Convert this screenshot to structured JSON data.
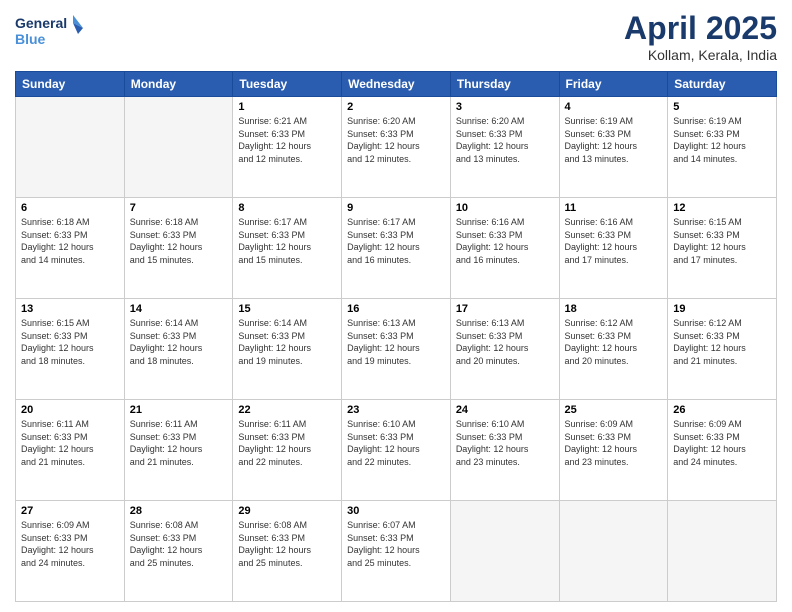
{
  "logo": {
    "line1": "General",
    "line2": "Blue"
  },
  "title": "April 2025",
  "subtitle": "Kollam, Kerala, India",
  "weekdays": [
    "Sunday",
    "Monday",
    "Tuesday",
    "Wednesday",
    "Thursday",
    "Friday",
    "Saturday"
  ],
  "weeks": [
    [
      {
        "day": "",
        "info": ""
      },
      {
        "day": "",
        "info": ""
      },
      {
        "day": "1",
        "info": "Sunrise: 6:21 AM\nSunset: 6:33 PM\nDaylight: 12 hours\nand 12 minutes."
      },
      {
        "day": "2",
        "info": "Sunrise: 6:20 AM\nSunset: 6:33 PM\nDaylight: 12 hours\nand 12 minutes."
      },
      {
        "day": "3",
        "info": "Sunrise: 6:20 AM\nSunset: 6:33 PM\nDaylight: 12 hours\nand 13 minutes."
      },
      {
        "day": "4",
        "info": "Sunrise: 6:19 AM\nSunset: 6:33 PM\nDaylight: 12 hours\nand 13 minutes."
      },
      {
        "day": "5",
        "info": "Sunrise: 6:19 AM\nSunset: 6:33 PM\nDaylight: 12 hours\nand 14 minutes."
      }
    ],
    [
      {
        "day": "6",
        "info": "Sunrise: 6:18 AM\nSunset: 6:33 PM\nDaylight: 12 hours\nand 14 minutes."
      },
      {
        "day": "7",
        "info": "Sunrise: 6:18 AM\nSunset: 6:33 PM\nDaylight: 12 hours\nand 15 minutes."
      },
      {
        "day": "8",
        "info": "Sunrise: 6:17 AM\nSunset: 6:33 PM\nDaylight: 12 hours\nand 15 minutes."
      },
      {
        "day": "9",
        "info": "Sunrise: 6:17 AM\nSunset: 6:33 PM\nDaylight: 12 hours\nand 16 minutes."
      },
      {
        "day": "10",
        "info": "Sunrise: 6:16 AM\nSunset: 6:33 PM\nDaylight: 12 hours\nand 16 minutes."
      },
      {
        "day": "11",
        "info": "Sunrise: 6:16 AM\nSunset: 6:33 PM\nDaylight: 12 hours\nand 17 minutes."
      },
      {
        "day": "12",
        "info": "Sunrise: 6:15 AM\nSunset: 6:33 PM\nDaylight: 12 hours\nand 17 minutes."
      }
    ],
    [
      {
        "day": "13",
        "info": "Sunrise: 6:15 AM\nSunset: 6:33 PM\nDaylight: 12 hours\nand 18 minutes."
      },
      {
        "day": "14",
        "info": "Sunrise: 6:14 AM\nSunset: 6:33 PM\nDaylight: 12 hours\nand 18 minutes."
      },
      {
        "day": "15",
        "info": "Sunrise: 6:14 AM\nSunset: 6:33 PM\nDaylight: 12 hours\nand 19 minutes."
      },
      {
        "day": "16",
        "info": "Sunrise: 6:13 AM\nSunset: 6:33 PM\nDaylight: 12 hours\nand 19 minutes."
      },
      {
        "day": "17",
        "info": "Sunrise: 6:13 AM\nSunset: 6:33 PM\nDaylight: 12 hours\nand 20 minutes."
      },
      {
        "day": "18",
        "info": "Sunrise: 6:12 AM\nSunset: 6:33 PM\nDaylight: 12 hours\nand 20 minutes."
      },
      {
        "day": "19",
        "info": "Sunrise: 6:12 AM\nSunset: 6:33 PM\nDaylight: 12 hours\nand 21 minutes."
      }
    ],
    [
      {
        "day": "20",
        "info": "Sunrise: 6:11 AM\nSunset: 6:33 PM\nDaylight: 12 hours\nand 21 minutes."
      },
      {
        "day": "21",
        "info": "Sunrise: 6:11 AM\nSunset: 6:33 PM\nDaylight: 12 hours\nand 21 minutes."
      },
      {
        "day": "22",
        "info": "Sunrise: 6:11 AM\nSunset: 6:33 PM\nDaylight: 12 hours\nand 22 minutes."
      },
      {
        "day": "23",
        "info": "Sunrise: 6:10 AM\nSunset: 6:33 PM\nDaylight: 12 hours\nand 22 minutes."
      },
      {
        "day": "24",
        "info": "Sunrise: 6:10 AM\nSunset: 6:33 PM\nDaylight: 12 hours\nand 23 minutes."
      },
      {
        "day": "25",
        "info": "Sunrise: 6:09 AM\nSunset: 6:33 PM\nDaylight: 12 hours\nand 23 minutes."
      },
      {
        "day": "26",
        "info": "Sunrise: 6:09 AM\nSunset: 6:33 PM\nDaylight: 12 hours\nand 24 minutes."
      }
    ],
    [
      {
        "day": "27",
        "info": "Sunrise: 6:09 AM\nSunset: 6:33 PM\nDaylight: 12 hours\nand 24 minutes."
      },
      {
        "day": "28",
        "info": "Sunrise: 6:08 AM\nSunset: 6:33 PM\nDaylight: 12 hours\nand 25 minutes."
      },
      {
        "day": "29",
        "info": "Sunrise: 6:08 AM\nSunset: 6:33 PM\nDaylight: 12 hours\nand 25 minutes."
      },
      {
        "day": "30",
        "info": "Sunrise: 6:07 AM\nSunset: 6:33 PM\nDaylight: 12 hours\nand 25 minutes."
      },
      {
        "day": "",
        "info": ""
      },
      {
        "day": "",
        "info": ""
      },
      {
        "day": "",
        "info": ""
      }
    ]
  ]
}
